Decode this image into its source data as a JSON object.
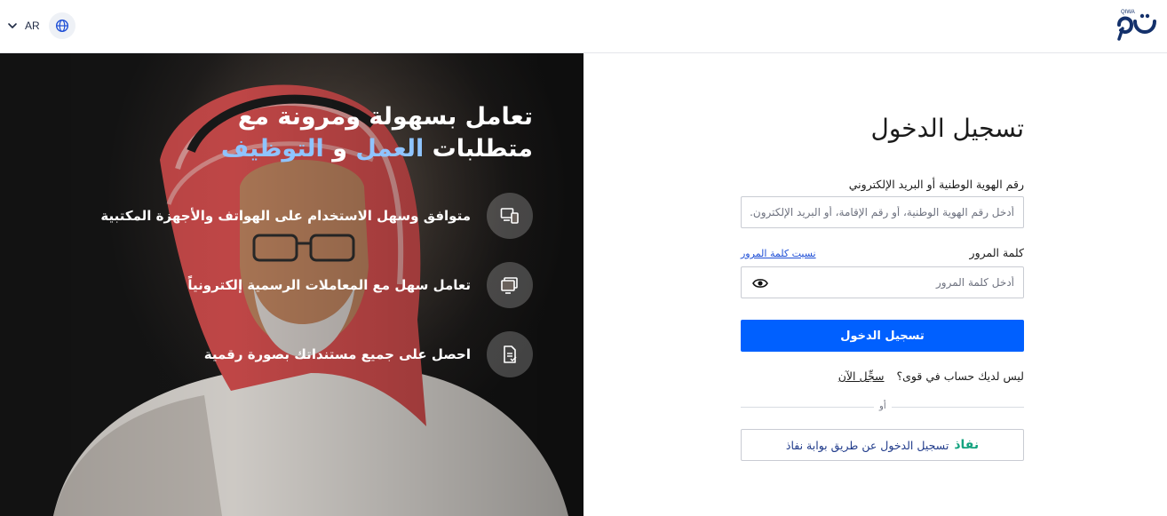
{
  "header": {
    "language_code": "AR",
    "icons": {
      "language_chevron": "chevron-down-icon",
      "globe": "globe-icon",
      "logo": "qiwa-logo"
    },
    "logo_text": "QIWA"
  },
  "hero": {
    "title_line1": "تعامل بسهولة ومرونة مع",
    "title_line2_prefix": "متطلبات",
    "title_line2_accent1": "العمل",
    "title_line2_and": "و",
    "title_line2_accent2": "التوظيف",
    "accent_color": "#8fc4ff",
    "features": [
      {
        "text": "متوافق وسهل الاستخدام على الهواتف والأجهزة المكتبية",
        "icon": "devices-icon"
      },
      {
        "text": "تعامل سهل مع المعاملات الرسمية إلكترونياً",
        "icon": "monitor-icon"
      },
      {
        "text": "احصل على جميع مستنداتك بصورة رقمية",
        "icon": "document-icon"
      }
    ]
  },
  "login": {
    "title": "تسجيل الدخول",
    "id_label": "رقم الهوية الوطنية أو البريد الإلكتروني",
    "id_placeholder": "أدخل رقم الهوية الوطنية، أو رقم الإقامة، أو البريد الإلكترون...",
    "password_label": "كلمة المرور",
    "forgot_password": "نسيت كلمة المرور",
    "password_placeholder": "أدخل كلمة المرور",
    "submit_label": "تسجيل الدخول",
    "no_account_text": "ليس لديك حساب في قوى؟",
    "register_link": "سجِّل الآن",
    "or_text": "أو",
    "nafath_logo": "نفاذ",
    "nafath_label": "تسجيل الدخول عن طريق بوابة نفاذ",
    "primary_color": "#0060ff",
    "nafath_color": "#14a37f"
  }
}
